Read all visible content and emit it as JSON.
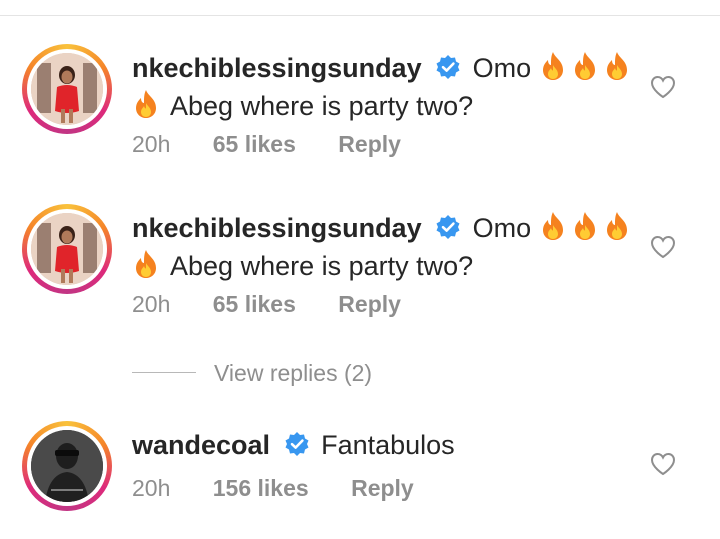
{
  "colors": {
    "verified": "#3897f0",
    "meta": "#8e8e8e",
    "fire_outer": "#f5821f",
    "fire_inner": "#ffcc33"
  },
  "comments": [
    {
      "username": "nkechiblessingsunday",
      "text_line1": "Omo",
      "text_line2": "Abeg where is party two?",
      "time": "20h",
      "likes": "65 likes",
      "reply": "Reply",
      "avatar_icon": "profile-photo"
    },
    {
      "username": "nkechiblessingsunday",
      "text_line1": "Omo",
      "text_line2": "Abeg where is party two?",
      "time": "20h",
      "likes": "65 likes",
      "reply": "Reply",
      "avatar_icon": "profile-photo"
    },
    {
      "username": "wandecoal",
      "text_line1": "Fantabulos",
      "time": "20h",
      "likes": "156 likes",
      "reply": "Reply",
      "avatar_icon": "profile-photo"
    }
  ],
  "view_replies": "View replies (2)"
}
